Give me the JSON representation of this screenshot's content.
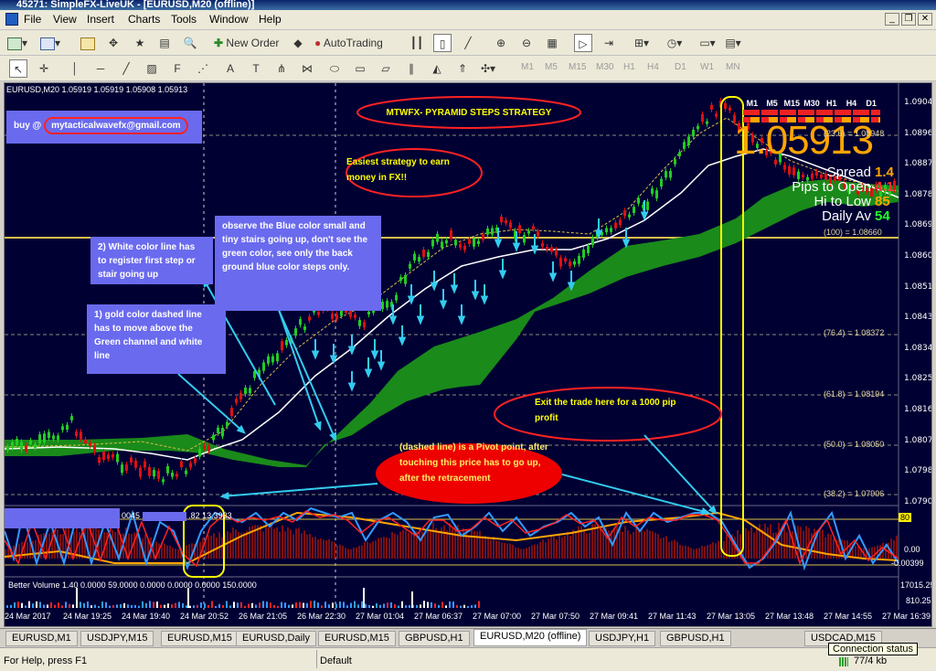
{
  "window": {
    "title": "45271: SimpleFX-LiveUK - [EURUSD,M20 (offline)]"
  },
  "menu": [
    "File",
    "View",
    "Insert",
    "Charts",
    "Tools",
    "Window",
    "Help"
  ],
  "toolbar": {
    "new_order": "New Order",
    "autotrading": "AutoTrading"
  },
  "timeframes": [
    "M1",
    "M5",
    "M15",
    "M30",
    "H1",
    "H4",
    "D1",
    "W1",
    "MN"
  ],
  "chart": {
    "header": "EURUSD,M20  1.05919 1.05919 1.05908 1.05913",
    "big_price": "1.05913",
    "stats": [
      {
        "label": "Spread",
        "value": "1.4",
        "color": "#ffa500"
      },
      {
        "label": "Pips to Open",
        "value": "4.1",
        "color": "#ff3333"
      },
      {
        "label": "Hi to Low",
        "value": "85",
        "color": "#ffa500"
      },
      {
        "label": "Daily Av",
        "value": "54",
        "color": "#22ff22"
      }
    ],
    "mtf_headers": [
      "M1",
      "M5",
      "M15",
      "M30",
      "H1",
      "H4",
      "D1"
    ],
    "price_axis": [
      "1.09045",
      "1.08960",
      "1.08870",
      "1.08780",
      "1.08695",
      "1.08605",
      "1.08515",
      "1.08430",
      "1.08340",
      "1.08250",
      "1.08165",
      "1.08075",
      "1.07985",
      "1.07900"
    ],
    "fib_levels": [
      "(23.6) = 1.08948",
      "(100) = 1.08660",
      "(76.4) = 1.08372",
      "(61.8) = 1.08194",
      "(50.0) = 1.08050",
      "(38.2) = 1.07906"
    ],
    "time_axis": [
      "24 Mar 2017",
      "24 Mar 19:25",
      "24 Mar 19:40",
      "24 Mar 20:52",
      "26 Mar 21:05",
      "26 Mar 22:30",
      "27 Mar 01:04",
      "27 Mar 06:37",
      "27 Mar 07:00",
      "27 Mar 07:50",
      "27 Mar 09:41",
      "27 Mar 11:43",
      "27 Mar 13:05",
      "27 Mar 13:48",
      "27 Mar 14:55",
      "27 Mar 16:39"
    ],
    "indicator1": {
      "label": "0045",
      "values": ".82 13.3933",
      "axis": [
        "80",
        "0.00",
        "-0.00399"
      ]
    },
    "indicator2": {
      "label": "Better Volume 1.40 0.0000 59.0000 0.0000 0.0000 0.0000 150.0000",
      "axis": [
        "17015.25",
        "810.25",
        "0.00"
      ]
    }
  },
  "annotations": {
    "title": "MTWFX- PYRAMID STEPS STRATEGY",
    "buy": "buy @ ",
    "email": "mytacticalwavefx@gmail.com",
    "easiest": "Easiest strategy to earn money in FX!!",
    "white_line": "2) White color line has to register first step or stair going up",
    "observe": "observe the Blue color small and tiny stairs going up, don't see the green color, see only the back ground blue color steps only.",
    "gold_line": "1) gold color dashed line has to move above the Green channel and white line",
    "exit": "Exit the trade here for a 1000 pip profit",
    "pivot": "(dashed line) is a Pivot point, after touching this price has to go up, after the retracement"
  },
  "tabs": [
    "EURUSD,M1",
    "USDJPY,M15",
    "EURUSD,M15",
    "EURUSD,Daily",
    "EURUSD,M15",
    "GBPUSD,H1",
    "EURUSD,M20 (offline)",
    "USDJPY,H1",
    "GBPUSD,H1",
    "USDCAD,M15"
  ],
  "status": {
    "help": "For Help, press F1",
    "profile": "Default",
    "connection": "77/4 kb",
    "tooltip": "Connection status"
  },
  "colors": {
    "chart_bg": "#000033",
    "bull": "#22cc22",
    "bear": "#dd1111",
    "channel": "#1a8a1a",
    "fib": "#e6d9a0"
  }
}
